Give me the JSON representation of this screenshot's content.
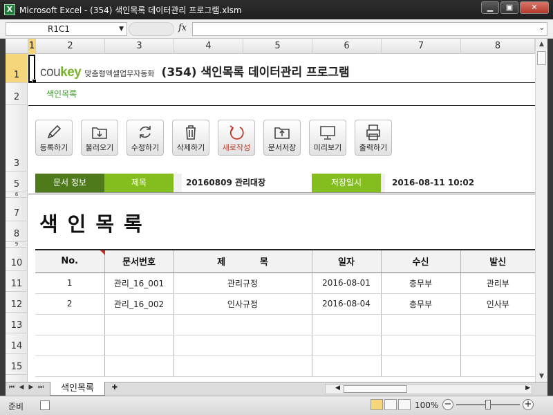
{
  "window": {
    "title": "Microsoft Excel - (354) 색인목록 데이터관리 프로그램.xlsm",
    "app_icon": "X",
    "minimize": "▁",
    "maximize": "▣",
    "close": "✕"
  },
  "formula": {
    "name_box": "R1C1",
    "fx_label": "fx",
    "value": ""
  },
  "columns": [
    "1",
    "2",
    "3",
    "4",
    "5",
    "6",
    "7",
    "8"
  ],
  "rows": [
    "1",
    "2",
    "3",
    "5",
    "6",
    "7",
    "8",
    "9",
    "10",
    "11",
    "12",
    "13",
    "14",
    "15"
  ],
  "header": {
    "logo_prefix": "cou",
    "logo_accent": "key",
    "tagline": "맞춤형엑셀업무자동화",
    "title": "(354) 색인목록 데이터관리 프로그램",
    "subtitle": "색인목록"
  },
  "toolbar": [
    {
      "label": "등록하기",
      "icon": "pencil-icon"
    },
    {
      "label": "불러오기",
      "icon": "folder-download-icon"
    },
    {
      "label": "수정하기",
      "icon": "refresh-icon"
    },
    {
      "label": "삭제하기",
      "icon": "trash-icon"
    },
    {
      "label": "새로작성",
      "icon": "circular-arrow-icon"
    },
    {
      "label": "문서저장",
      "icon": "folder-upload-icon"
    },
    {
      "label": "미리보기",
      "icon": "monitor-icon"
    },
    {
      "label": "출력하기",
      "icon": "printer-icon"
    }
  ],
  "doc_info": {
    "section_label": "문서 정보",
    "title_label": "제목",
    "title_value": "20160809 관리대장",
    "saved_label": "저장일시",
    "saved_value": "2016-08-11 10:02"
  },
  "big_title": "색인목록",
  "table": {
    "headers": [
      "No.",
      "문서번호",
      "제           목",
      "일자",
      "수신",
      "발신"
    ],
    "rows": [
      [
        "1",
        "관리_16_001",
        "관리규정",
        "2016-08-01",
        "총무부",
        "관리부"
      ],
      [
        "2",
        "관리_16_002",
        "인사규정",
        "2016-08-04",
        "총무부",
        "인사부"
      ],
      [
        "",
        "",
        "",
        "",
        "",
        ""
      ],
      [
        "",
        "",
        "",
        "",
        "",
        ""
      ],
      [
        "",
        "",
        "",
        "",
        "",
        ""
      ]
    ]
  },
  "sheet_tab": "색인목록",
  "status": {
    "ready": "준비",
    "zoom": "100%",
    "zoom_level_percent": 100
  },
  "colors": {
    "dark_green": "#4f7a1c",
    "light_green": "#84bd1e",
    "accent_green": "#7ab32e",
    "new_button_red": "#c0392b"
  }
}
